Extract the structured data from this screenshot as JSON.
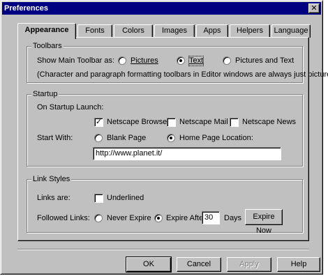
{
  "window": {
    "title": "Preferences",
    "close_glyph": "✕"
  },
  "tabs": [
    {
      "label": "Appearance",
      "active": true
    },
    {
      "label": "Fonts"
    },
    {
      "label": "Colors"
    },
    {
      "label": "Images"
    },
    {
      "label": "Apps"
    },
    {
      "label": "Helpers"
    },
    {
      "label": "Language"
    }
  ],
  "toolbars": {
    "group_label": "Toolbars",
    "show_label": "Show Main Toolbar as:",
    "options": [
      "Pictures",
      "Text",
      "Pictures and Text"
    ],
    "selected": "Text",
    "note": "(Character and paragraph formatting toolbars in Editor windows are always just pictures.)"
  },
  "startup": {
    "group_label": "Startup",
    "launch_label": "On Startup Launch:",
    "launch_items": [
      {
        "label": "Netscape Browser",
        "checked": true
      },
      {
        "label": "Netscape Mail",
        "checked": false
      },
      {
        "label": "Netscape News",
        "checked": false
      }
    ],
    "start_with_label": "Start With:",
    "start_options": [
      "Blank Page",
      "Home Page Location:"
    ],
    "start_selected": "Home Page Location:",
    "home_url": "http://www.planet.it/"
  },
  "links": {
    "group_label": "Link Styles",
    "links_are_label": "Links are:",
    "underlined_label": "Underlined",
    "underlined_checked": false,
    "followed_label": "Followed Links:",
    "never_expire_label": "Never Expire",
    "expire_after_label": "Expire After:",
    "expire_selected": "Expire After:",
    "expire_days": "30",
    "days_label": "Days",
    "expire_now_label": "Expire Now"
  },
  "footer": {
    "ok": "OK",
    "cancel": "Cancel",
    "apply": "Apply",
    "help": "Help"
  },
  "check_glyph": "✓"
}
